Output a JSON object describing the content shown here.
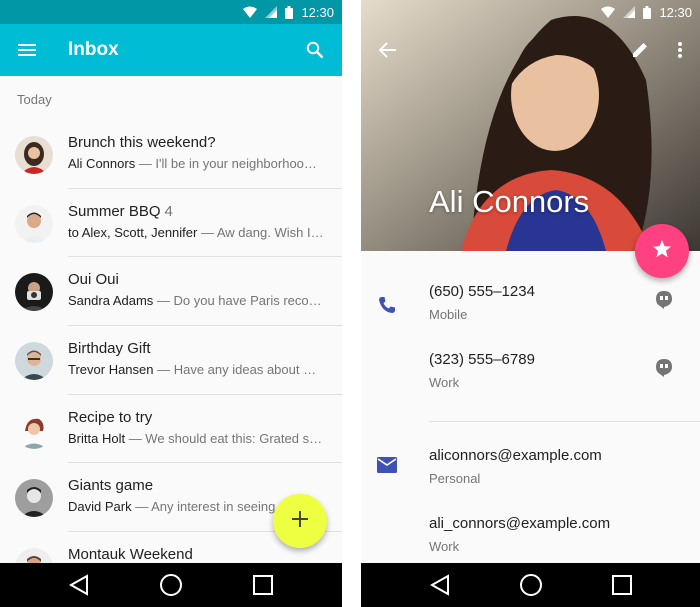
{
  "inbox": {
    "status": {
      "time": "12:30"
    },
    "title": "Inbox",
    "section": "Today",
    "items": [
      {
        "subject": "Brunch this weekend?",
        "count": "",
        "from": "Ali Connors",
        "preview": " — I'll be in your neighborhood doing errands this weekend"
      },
      {
        "subject": "Summer BBQ",
        "count": "4",
        "from": "to Alex, Scott, Jennifer",
        "preview": " — Aw dang. Wish I could make it"
      },
      {
        "subject": "Oui Oui",
        "count": "",
        "from": "Sandra Adams",
        "preview": " — Do you have Paris recommendations"
      },
      {
        "subject": "Birthday Gift",
        "count": "",
        "from": "Trevor Hansen",
        "preview": " — Have any ideas about what we should get"
      },
      {
        "subject": "Recipe to try",
        "count": "",
        "from": "Britta Holt",
        "preview": " — We should eat this: Grated squash"
      },
      {
        "subject": "Giants game",
        "count": "",
        "from": "David Park",
        "preview": " — Any interest in seeing the game"
      },
      {
        "subject": "Montauk Weekend",
        "count": "",
        "from": "",
        "preview": ""
      }
    ],
    "fab_icon": "add-icon"
  },
  "contact": {
    "status": {
      "time": "12:30"
    },
    "name": "Ali Connors",
    "phones": [
      {
        "number": "(650) 555–1234",
        "type": "Mobile"
      },
      {
        "number": "(323) 555–6789",
        "type": "Work"
      }
    ],
    "emails": [
      {
        "address": "aliconnors@example.com",
        "type": "Personal"
      },
      {
        "address": "ali_connors@example.com",
        "type": "Work"
      }
    ],
    "fab_icon": "star-icon"
  },
  "colors": {
    "inbox_primary": "#00bcd4",
    "inbox_status": "#0097a7",
    "inbox_fab": "#eeff41",
    "contact_fab": "#ff4081",
    "contact_icon": "#3f51b5"
  }
}
